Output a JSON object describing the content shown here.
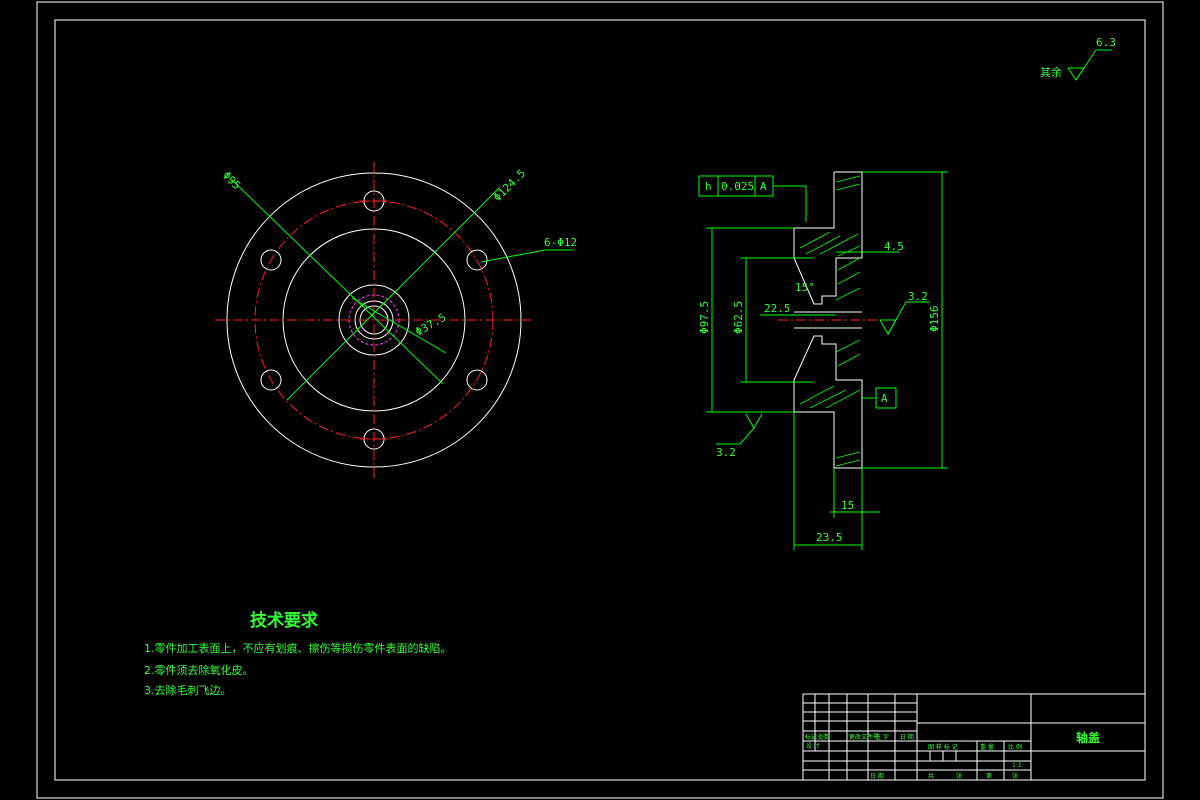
{
  "dimensions": {
    "bolt_circle": "Φ95",
    "outer_diameter_front": "Φ124.5",
    "holes": "6-Φ12",
    "bore": "Φ37.5",
    "outer_diameter_side": "Φ156",
    "boss_diameter": "Φ97.5",
    "pilot_diameter": "Φ62.5",
    "step_width": "4.5",
    "depth": "22.5",
    "angle": "15°",
    "flange_thickness": "15",
    "total_width": "23.5"
  },
  "tolerance": {
    "symbol": "h",
    "value": "0.025",
    "datum": "A"
  },
  "datum_label": "A",
  "roughness": {
    "general_prefix": "其余",
    "general": "6.3",
    "face": "3.2",
    "bottom": "3.2"
  },
  "tech_requirements": {
    "title": "技术要求",
    "items": [
      "1.零件加工表面上，不应有划痕、擦伤等损伤零件表面的缺陷。",
      "2.零件须去除氧化皮。",
      "3.去除毛刺飞边。"
    ]
  },
  "title_block": {
    "part_name": "轴盖",
    "headers": [
      "标记",
      "处数",
      "更改文件号",
      "签 字",
      "日 期"
    ],
    "row2": [
      "设 计"
    ],
    "stage_headers": [
      "图 样 标 记",
      "重 量",
      "比 例"
    ],
    "scale": "1:1",
    "sheet": [
      "共",
      "张",
      "第",
      "张"
    ],
    "approve": "日 期"
  }
}
